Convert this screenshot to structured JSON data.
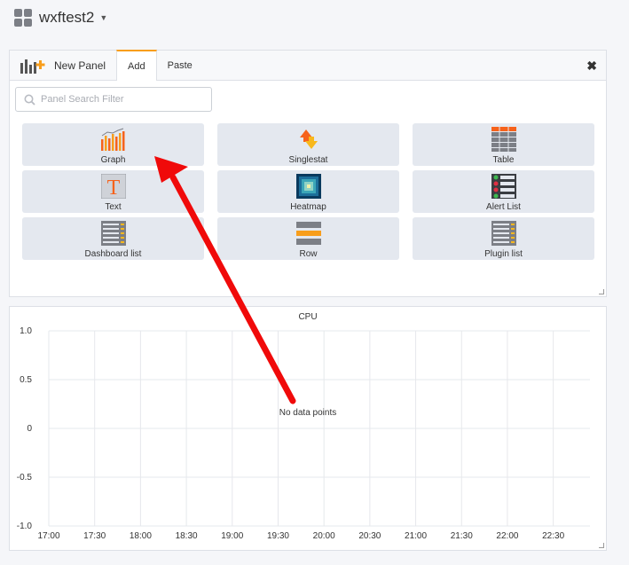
{
  "dashboard": {
    "title": "wxftest2"
  },
  "add_panel": {
    "header_label": "New Panel",
    "tabs": [
      {
        "label": "Add"
      },
      {
        "label": "Paste"
      }
    ],
    "close_icon": "close-icon",
    "search": {
      "placeholder": "Panel Search Filter",
      "value": ""
    },
    "cards": [
      {
        "label": "Graph",
        "icon": "graph-icon"
      },
      {
        "label": "Singlestat",
        "icon": "singlestat-icon"
      },
      {
        "label": "Table",
        "icon": "table-icon"
      },
      {
        "label": "Text",
        "icon": "text-icon"
      },
      {
        "label": "Heatmap",
        "icon": "heatmap-icon"
      },
      {
        "label": "Alert List",
        "icon": "alert-list-icon"
      },
      {
        "label": "Dashboard list",
        "icon": "dashboard-list-icon"
      },
      {
        "label": "Row",
        "icon": "row-icon"
      },
      {
        "label": "Plugin list",
        "icon": "plugin-list-icon"
      }
    ]
  },
  "cpu_panel": {
    "title": "CPU",
    "no_data": "No data points"
  },
  "chart_data": {
    "type": "line",
    "title": "CPU",
    "series": [],
    "x": [
      "17:00",
      "17:30",
      "18:00",
      "18:30",
      "19:00",
      "19:30",
      "20:00",
      "20:30",
      "21:00",
      "21:30",
      "22:00",
      "22:30"
    ],
    "y_ticks": [
      "1.0",
      "0.5",
      "0",
      "-0.5",
      "-1.0"
    ],
    "ylim": [
      -1.0,
      1.0
    ],
    "grid": true,
    "annotation": "No data points"
  },
  "colors": {
    "accent": "#f89e1c",
    "arrow": "#f00a0a",
    "card_bg": "#e4e8ef"
  }
}
